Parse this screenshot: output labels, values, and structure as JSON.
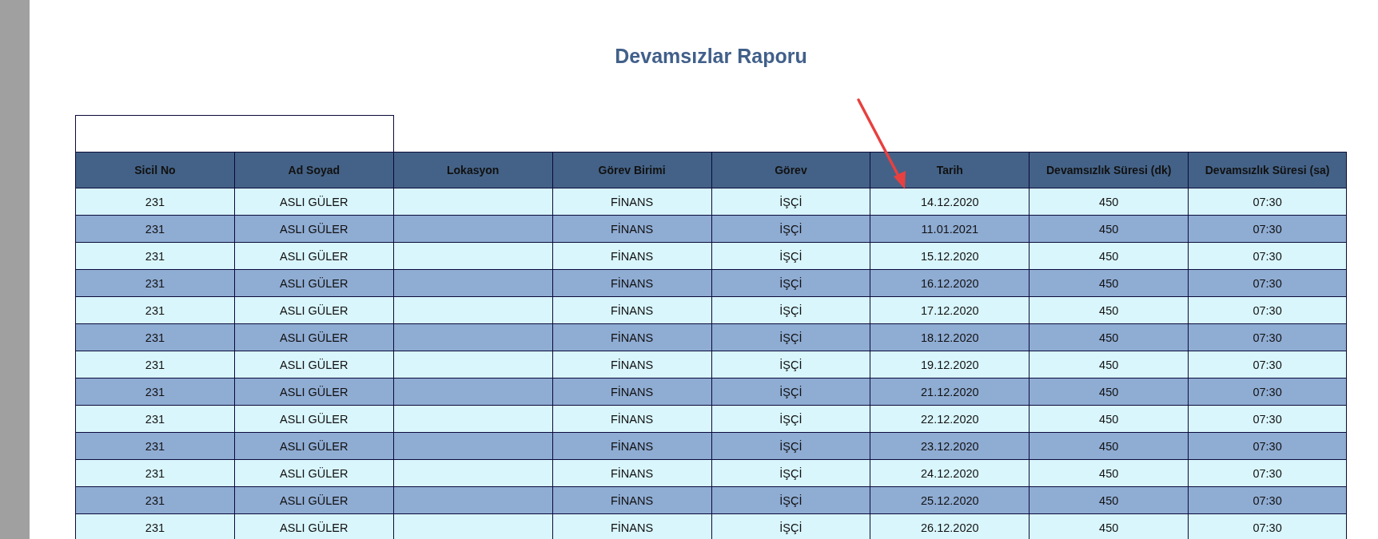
{
  "report": {
    "title": "Devamsızlar Raporu"
  },
  "table": {
    "columns": [
      "Sicil No",
      "Ad Soyad",
      "Lokasyon",
      "Görev Birimi",
      "Görev",
      "Tarih",
      "Devamsızlık Süresi (dk)",
      "Devamsızlık Süresi (sa)"
    ],
    "rows": [
      {
        "sicil_no": "231",
        "ad_soyad": "ASLI GÜLER",
        "gorev_birimi": "FİNANS",
        "gorev": "İŞÇİ",
        "tarih": "14.12.2020",
        "sure_dk": "450",
        "sure_sa": "07:30"
      },
      {
        "sicil_no": "231",
        "ad_soyad": "ASLI GÜLER",
        "gorev_birimi": "FİNANS",
        "gorev": "İŞÇİ",
        "tarih": "11.01.2021",
        "sure_dk": "450",
        "sure_sa": "07:30"
      },
      {
        "sicil_no": "231",
        "ad_soyad": "ASLI GÜLER",
        "gorev_birimi": "FİNANS",
        "gorev": "İŞÇİ",
        "tarih": "15.12.2020",
        "sure_dk": "450",
        "sure_sa": "07:30"
      },
      {
        "sicil_no": "231",
        "ad_soyad": "ASLI GÜLER",
        "gorev_birimi": "FİNANS",
        "gorev": "İŞÇİ",
        "tarih": "16.12.2020",
        "sure_dk": "450",
        "sure_sa": "07:30"
      },
      {
        "sicil_no": "231",
        "ad_soyad": "ASLI GÜLER",
        "gorev_birimi": "FİNANS",
        "gorev": "İŞÇİ",
        "tarih": "17.12.2020",
        "sure_dk": "450",
        "sure_sa": "07:30"
      },
      {
        "sicil_no": "231",
        "ad_soyad": "ASLI GÜLER",
        "gorev_birimi": "FİNANS",
        "gorev": "İŞÇİ",
        "tarih": "18.12.2020",
        "sure_dk": "450",
        "sure_sa": "07:30"
      },
      {
        "sicil_no": "231",
        "ad_soyad": "ASLI GÜLER",
        "gorev_birimi": "FİNANS",
        "gorev": "İŞÇİ",
        "tarih": "19.12.2020",
        "sure_dk": "450",
        "sure_sa": "07:30"
      },
      {
        "sicil_no": "231",
        "ad_soyad": "ASLI GÜLER",
        "gorev_birimi": "FİNANS",
        "gorev": "İŞÇİ",
        "tarih": "21.12.2020",
        "sure_dk": "450",
        "sure_sa": "07:30"
      },
      {
        "sicil_no": "231",
        "ad_soyad": "ASLI GÜLER",
        "gorev_birimi": "FİNANS",
        "gorev": "İŞÇİ",
        "tarih": "22.12.2020",
        "sure_dk": "450",
        "sure_sa": "07:30"
      },
      {
        "sicil_no": "231",
        "ad_soyad": "ASLI GÜLER",
        "gorev_birimi": "FİNANS",
        "gorev": "İŞÇİ",
        "tarih": "23.12.2020",
        "sure_dk": "450",
        "sure_sa": "07:30"
      },
      {
        "sicil_no": "231",
        "ad_soyad": "ASLI GÜLER",
        "gorev_birimi": "FİNANS",
        "gorev": "İŞÇİ",
        "tarih": "24.12.2020",
        "sure_dk": "450",
        "sure_sa": "07:30"
      },
      {
        "sicil_no": "231",
        "ad_soyad": "ASLI GÜLER",
        "gorev_birimi": "FİNANS",
        "gorev": "İŞÇİ",
        "tarih": "25.12.2020",
        "sure_dk": "450",
        "sure_sa": "07:30"
      },
      {
        "sicil_no": "231",
        "ad_soyad": "ASLI GÜLER",
        "gorev_birimi": "FİNANS",
        "gorev": "İŞÇİ",
        "tarih": "26.12.2020",
        "sure_dk": "450",
        "sure_sa": "07:30"
      }
    ]
  }
}
